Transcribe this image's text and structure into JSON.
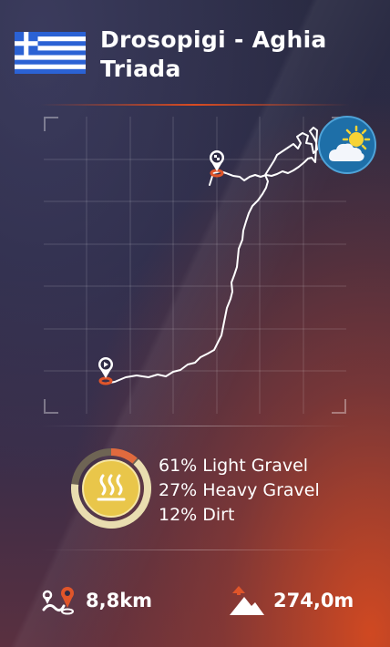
{
  "route": {
    "title": "Drosopigi - Aghia Triada",
    "country_flag": "greece-flag"
  },
  "map": {
    "weather_icon": "partly-cloudy-icon",
    "start_marker_icon": "play-pin-icon",
    "end_marker_icon": "finish-pin-icon"
  },
  "surface": {
    "items": [
      {
        "percent": "61%",
        "label": "Light Gravel"
      },
      {
        "percent": "27%",
        "label": "Heavy Gravel"
      },
      {
        "percent": "12%",
        "label": "Dirt"
      }
    ],
    "icon": "heat-waves-icon",
    "colors": {
      "light_gravel": "#e9ddb0",
      "heavy_gravel": "#6e6454",
      "dirt": "#e06a3e",
      "accent": "#d94b21"
    }
  },
  "stats": {
    "distance": "8,8km",
    "distance_icon": "route-distance-icon",
    "elevation": "274,0m",
    "elevation_icon": "elevation-gain-icon"
  }
}
